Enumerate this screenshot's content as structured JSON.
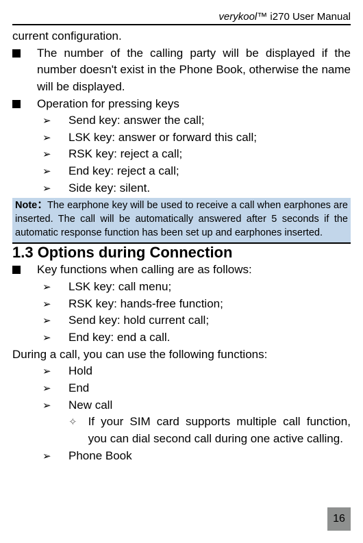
{
  "header": {
    "brand": "verykool",
    "tm": "™",
    "model": " i270 User Manual"
  },
  "intro_cont": "current configuration.",
  "b1": "The number of the calling party will be displayed if the number doesn't exist in the Phone Book, otherwise the name will be displayed.",
  "b2": "Operation for pressing keys",
  "ops": [
    "Send key: answer the call;",
    "LSK key: answer or forward this call;",
    "RSK key: reject a call;",
    "End key: reject a call;",
    "Side key: silent."
  ],
  "note": {
    "label": "Note：",
    "text": "The earphone key will be used to receive a call when earphones are inserted. The call will be automatically answered after 5 seconds if the automatic response function has been set up and earphones inserted."
  },
  "section": "1.3 Options during Connection",
  "b3": "Key functions when calling are as follows:",
  "keys": [
    "LSK key: call menu;",
    "RSK key: hands-free function;",
    "Send key: hold current call;",
    "End key: end a call."
  ],
  "during": "During a call, you can use the following functions:",
  "funcs_a": [
    "Hold",
    "End",
    "New call"
  ],
  "sim_note": "If your SIM card supports multiple call function, you can dial second call during one active calling.",
  "funcs_b": [
    "Phone Book"
  ],
  "page": "16"
}
